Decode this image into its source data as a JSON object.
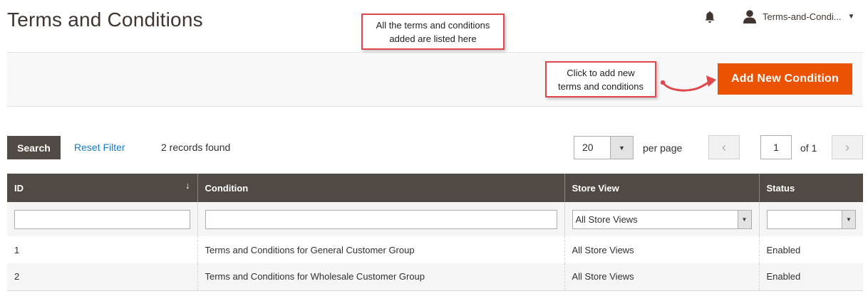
{
  "page": {
    "title": "Terms and Conditions"
  },
  "header": {
    "user_name": "Terms-and-Condi...",
    "caret": "▼"
  },
  "callouts": {
    "list_note_line1": "All the terms and conditions",
    "list_note_line2": "added are listed here",
    "add_note_line1": "Click to add new",
    "add_note_line2": "terms and conditions"
  },
  "actions": {
    "add_label": "Add New Condition"
  },
  "toolbar": {
    "search_label": "Search",
    "reset_label": "Reset Filter",
    "records_text": "2 records found",
    "per_page_value": "20",
    "per_page_label": "per page",
    "page_value": "1",
    "of_total": "of 1"
  },
  "grid": {
    "columns": [
      "ID",
      "Condition",
      "Store View",
      "Status"
    ],
    "sort_indicator": "↓",
    "filters": {
      "store_view": "All Store Views",
      "status": ""
    },
    "rows": [
      {
        "id": "1",
        "condition": "Terms and Conditions for General Customer Group",
        "store_view": "All Store Views",
        "status": "Enabled"
      },
      {
        "id": "2",
        "condition": "Terms and Conditions for Wholesale Customer Group",
        "store_view": "All Store Views",
        "status": "Enabled"
      }
    ]
  },
  "colors": {
    "primary": "#eb5202",
    "header_bg": "#514943",
    "link": "#1979c3",
    "callout_border": "#e0474c"
  },
  "icons": {
    "notifications": "bell-icon",
    "account": "user-icon",
    "prev": "chevron-left-icon",
    "next": "chevron-right-icon",
    "dropdown": "triangle-down-icon"
  }
}
